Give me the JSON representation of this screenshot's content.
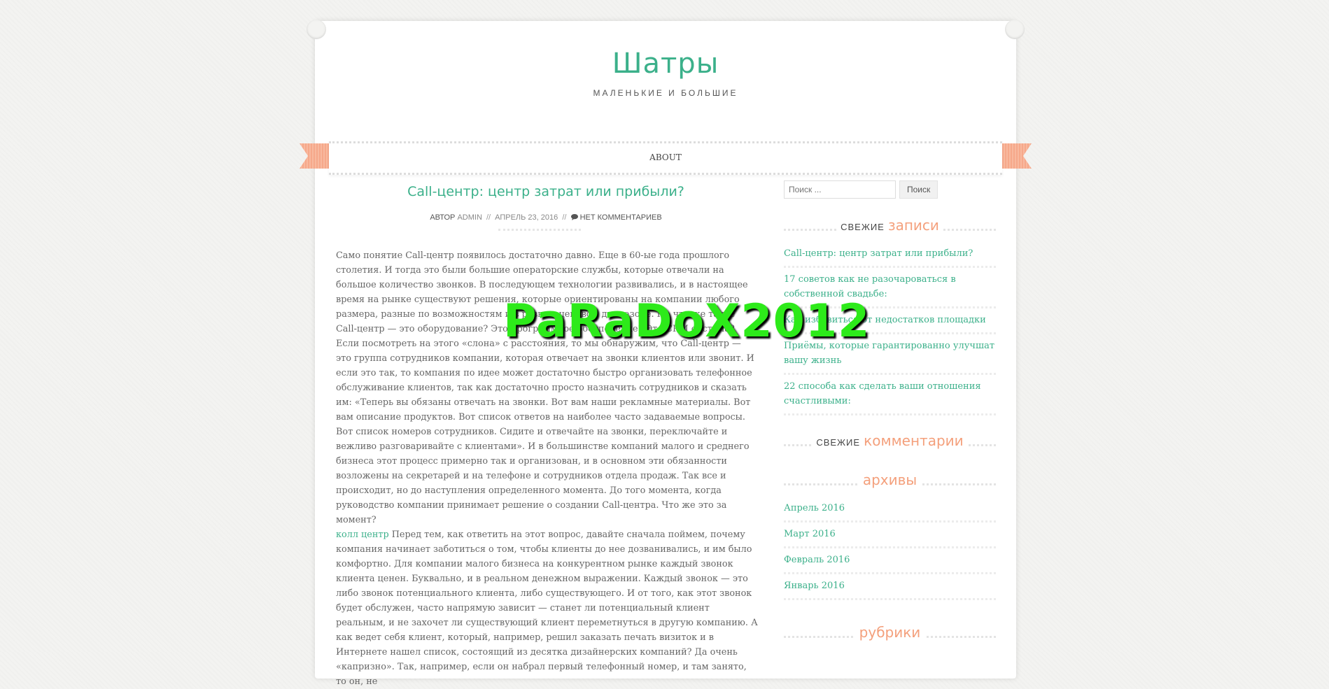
{
  "site": {
    "title": "Шатры",
    "description": "МАЛЕНЬКИЕ И БОЛЬШИЕ"
  },
  "nav": {
    "about": "About"
  },
  "post": {
    "title": "Call-центр: центр затрат или прибыли?",
    "meta": {
      "author_prefix": "АВТОР",
      "author": "ADMIN",
      "separator": "//",
      "date": "АПРЕЛЬ 23, 2016",
      "comments": "НЕТ КОММЕНТАРИЕВ",
      "comments_icon": "comment-icon"
    },
    "paragraph1": "Само понятие Call-центр появилось достаточно давно. Еще в 60-ые года прошлого столетия. И тогда это были большие операторские службы, которые отвечали на большое количество звонков. В последующем технологии развивались, и в настоящее время на рынке существуют решения, которые ориентированы на компании любого размера, разные по возможностям и в разном ценовом диапазоне. Но что же такое Call-центр — это оборудование? Это программное обеспечение? Это CRM система? Если посмотреть на этого «слона» с расстояния, то мы обнаружим, что Call-центр — это группа сотрудников компании, которая отвечает на звонки клиентов или звонит. И если это так, то компания по идее может достаточно быстро организовать телефонное обслуживание клиентов, так как достаточно просто назначить сотрудников и сказать им: «Теперь вы обязаны отвечать на звонки. Вот вам наши рекламные материалы. Вот вам описание продуктов. Вот список ответов на наиболее часто задаваемые вопросы. Вот список номеров сотрудников. Сидите и отвечайте на звонки, переключайте и вежливо разговаривайте с клиентами». И в большинстве компаний малого и среднего бизнеса этот процесс примерно так и организован, и в основном эти обязанности возложены на секретарей и на телефоне и сотрудников отдела продаж. Так все и происходит, но до наступления определенного момента. До того момента, когда руководство компании принимает решение о создании Call-центра. Что же это за момент?",
    "link": "колл центр",
    "paragraph2": " Перед тем, как ответить на этот вопрос, давайте сначала поймем, почему компания начинает заботиться о том, чтобы клиенты до нее дозванивались, и им было комфортно. Для компании малого бизнеса на конкурентном рынке каждый звонок клиента ценен. Буквально, и в реальном денежном выражении. Каждый звонок — это либо звонок потенциального клиента, либо существующего. И от того, как этот звонок будет обслужен, часто напрямую зависит — станет ли потенциальный клиент реальным, и не захочет ли существующий клиент переметнуться в другую компанию. А как ведет себя клиент, который, например, решил заказать печать визиток и в Интернете нашел список, состоящий из десятка дизайнерских компаний? Да очень «капризно». Так, например, если он набрал первый телефонный номер, и там занято, то он, не"
  },
  "sidebar": {
    "search": {
      "placeholder": "Поиск ...",
      "button": "Поиск"
    },
    "recent_posts": {
      "title_small": "СВЕЖИЕ",
      "title_big": "записи",
      "items": [
        "Call-центр: центр затрат или прибыли?",
        "17 советов как не разочароваться в собственной свадьбе:",
        "Как избавиться от недостатков площадки",
        "Приёмы, которые гарантированно улучшат вашу жизнь",
        "22 способа как сделать ваши отношения счастливыми:"
      ]
    },
    "recent_comments": {
      "title_small": "СВЕЖИЕ",
      "title_big": "комментарии"
    },
    "archives": {
      "title": "архивы",
      "items": [
        "Апрель 2016",
        "Март 2016",
        "Февраль 2016",
        "Январь 2016"
      ]
    },
    "categories": {
      "title": "рубрики"
    }
  },
  "watermark": "PaRaDoX2012",
  "colors": {
    "accent": "#3bb08a",
    "ribbon": "#f6a88a",
    "heading_orange": "#f4a07c",
    "watermark": "#2dea1a"
  }
}
